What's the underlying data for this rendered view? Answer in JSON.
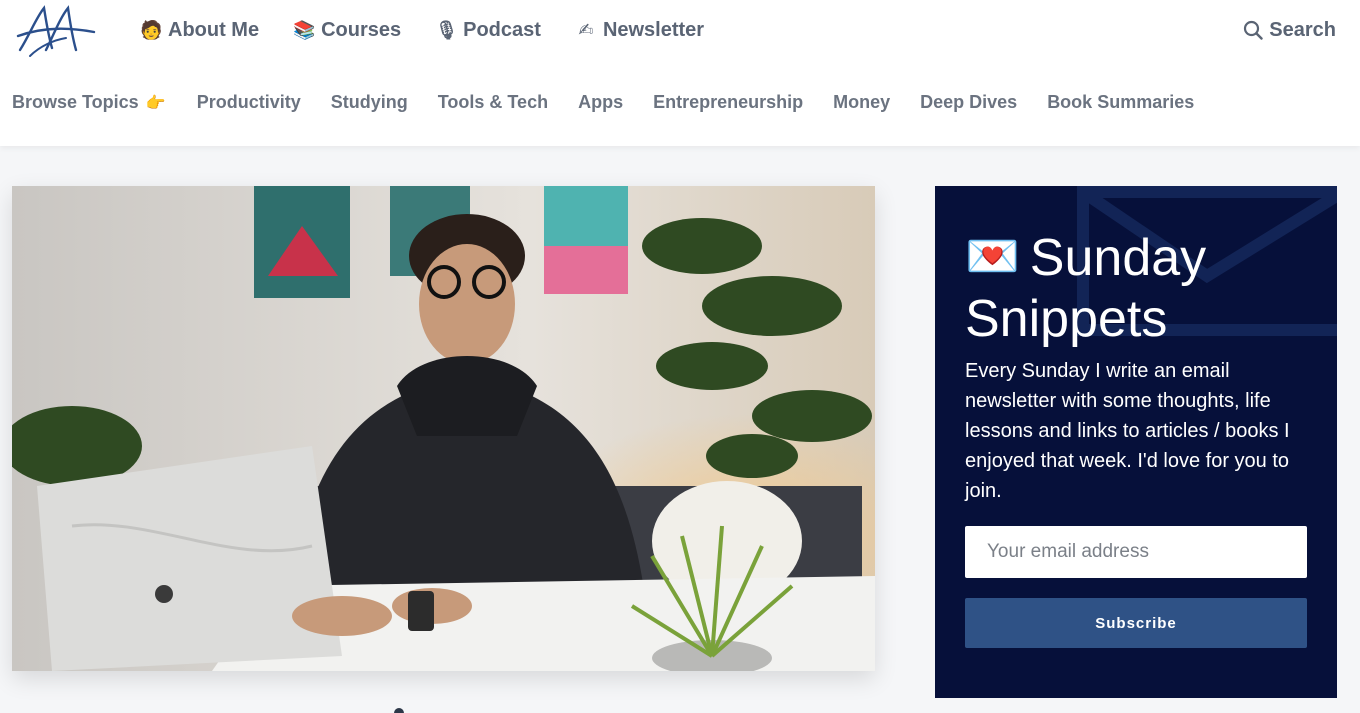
{
  "header": {
    "logo_text": "AA",
    "nav": [
      {
        "label": "About Me",
        "icon": "person-icon",
        "emoji": "🧑"
      },
      {
        "label": "Courses",
        "icon": "books-icon",
        "emoji": "📚"
      },
      {
        "label": "Podcast",
        "icon": "microphone-icon",
        "emoji": "🎙"
      },
      {
        "label": "Newsletter",
        "icon": "writing-hand-icon",
        "emoji": "✍"
      }
    ],
    "search_label": "Search"
  },
  "topics": {
    "browse_label": "Browse Topics",
    "browse_emoji": "👉",
    "items": [
      "Productivity",
      "Studying",
      "Tools & Tech",
      "Apps",
      "Entrepreneurship",
      "Money",
      "Deep Dives",
      "Book Summaries"
    ]
  },
  "newsletter": {
    "emoji": "💌",
    "title": "Sunday Snippets",
    "description": "Every Sunday I write an email newsletter with some thoughts, life lessons and links to articles / books I enjoyed that week. I'd love for you to join.",
    "email_placeholder": "Your email address",
    "email_value": "",
    "subscribe_label": "Subscribe"
  },
  "colors": {
    "card_bg": "#06103a",
    "button_bg": "#2f5286",
    "nav_text": "#5a6474",
    "logo_blue": "#2b4f8c"
  }
}
